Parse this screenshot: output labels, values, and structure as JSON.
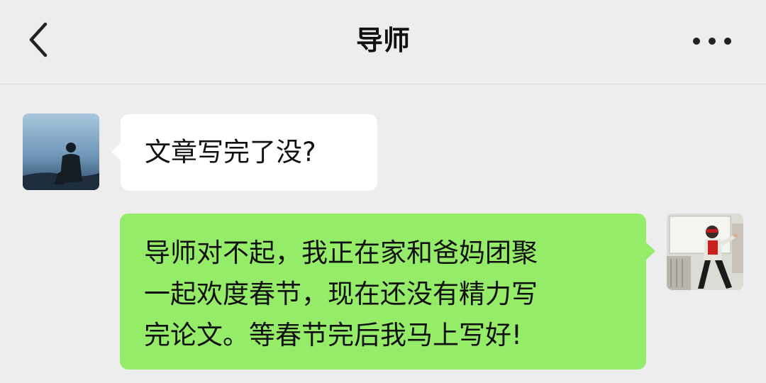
{
  "header": {
    "title": "导师",
    "back_icon": "chevron-left-icon",
    "more_icon": "more-dots-icon"
  },
  "messages": [
    {
      "from": "incoming",
      "sender": "mentor",
      "avatar_icon": "silhouette-photo-avatar",
      "text": "文章写完了没?"
    },
    {
      "from": "outgoing",
      "sender": "self",
      "avatar_icon": "person-photo-avatar",
      "text": "导师对不起，我正在家和爸妈团聚\n一起欢度春节，现在还没有精力写\n完论文。等春节完后我马上写好!"
    }
  ],
  "colors": {
    "background": "#ededed",
    "incoming_bubble": "#ffffff",
    "outgoing_bubble": "#95ec69",
    "text": "#111111"
  }
}
